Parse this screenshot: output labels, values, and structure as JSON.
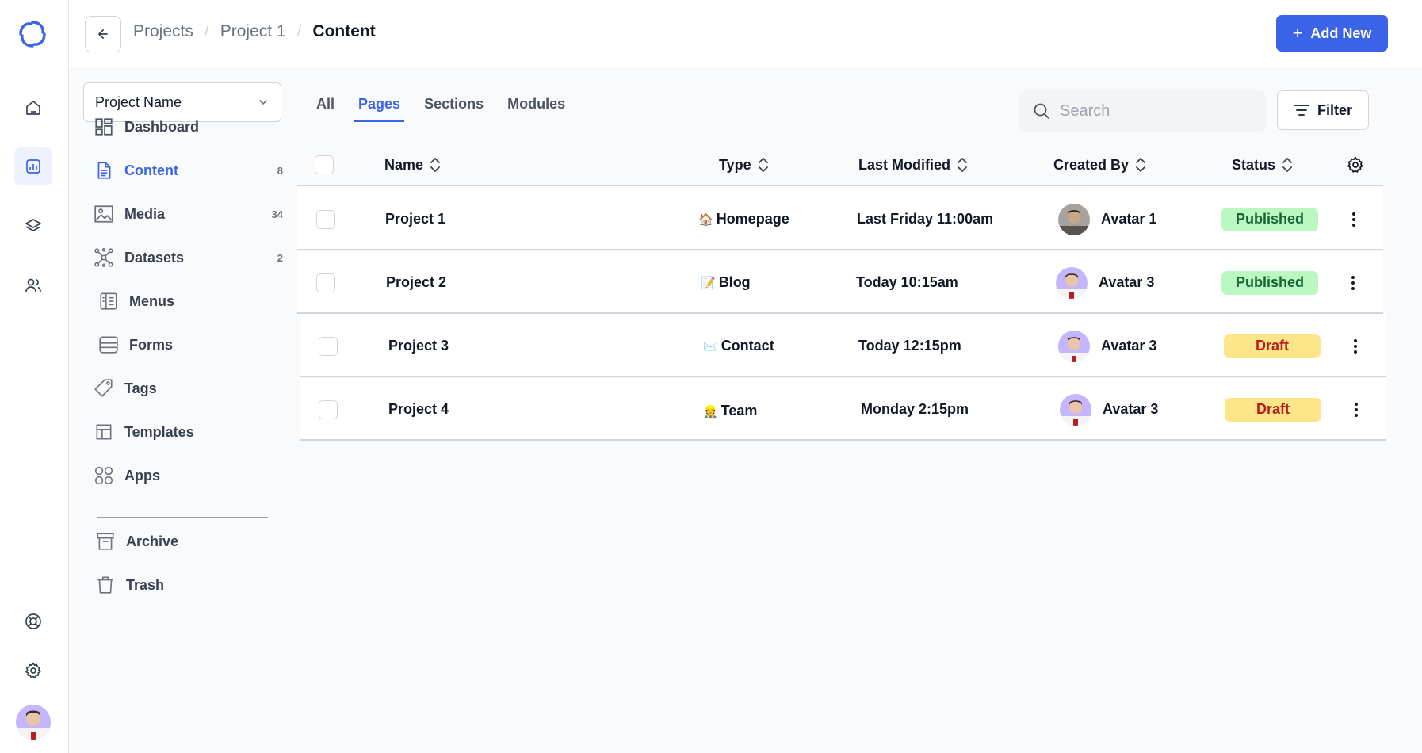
{
  "header": {
    "breadcrumbs": [
      "Projects",
      "Project 1",
      "Content"
    ],
    "add_new_label": "Add New"
  },
  "subnav": {
    "project_select_value": "Project Name",
    "items": [
      {
        "label": "Dashboard",
        "count": "",
        "icon": "dashboard-icon"
      },
      {
        "label": "Content",
        "count": "8",
        "icon": "document-icon"
      },
      {
        "label": "Media",
        "count": "34",
        "icon": "image-icon"
      },
      {
        "label": "Datasets",
        "count": "2",
        "icon": "network-icon"
      },
      {
        "label": "Menus",
        "count": "",
        "icon": "menu-book-icon"
      },
      {
        "label": "Forms",
        "count": "",
        "icon": "form-icon"
      },
      {
        "label": "Tags",
        "count": "",
        "icon": "tag-icon"
      },
      {
        "label": "Templates",
        "count": "",
        "icon": "template-icon"
      },
      {
        "label": "Apps",
        "count": "",
        "icon": "apps-icon"
      }
    ],
    "bottom_items": [
      {
        "label": "Archive",
        "icon": "archive-icon"
      },
      {
        "label": "Trash",
        "icon": "trash-icon"
      }
    ]
  },
  "tabs": [
    "All",
    "Pages",
    "Sections",
    "Modules"
  ],
  "active_tab": "Pages",
  "search": {
    "placeholder": "Search"
  },
  "filter_label": "Filter",
  "table": {
    "columns": [
      "Name",
      "Type",
      "Last Modified",
      "Created By",
      "Status"
    ],
    "rows": [
      {
        "name": "Project 1",
        "type_emoji": "🏠",
        "type": "Homepage",
        "modified": "Last Friday 11:00am",
        "author": "Avatar 1",
        "status": "Published"
      },
      {
        "name": "Project 2",
        "type_emoji": "📝",
        "type": "Blog",
        "modified": "Today 10:15am",
        "author": "Avatar 3",
        "status": "Published"
      },
      {
        "name": "Project 3",
        "type_emoji": "✉️",
        "type": "Contact",
        "modified": "Today 12:15pm",
        "author": "Avatar 3",
        "status": "Draft"
      },
      {
        "name": "Project 4",
        "type_emoji": "👷",
        "type": "Team",
        "modified": "Monday 2:15pm",
        "author": "Avatar 3",
        "status": "Draft"
      }
    ]
  },
  "colors": {
    "accent": "#3b63e8",
    "published_bg": "#bbf7c0",
    "published_text": "#166534",
    "draft_bg": "#fde68a",
    "draft_text": "#b91c1c"
  }
}
